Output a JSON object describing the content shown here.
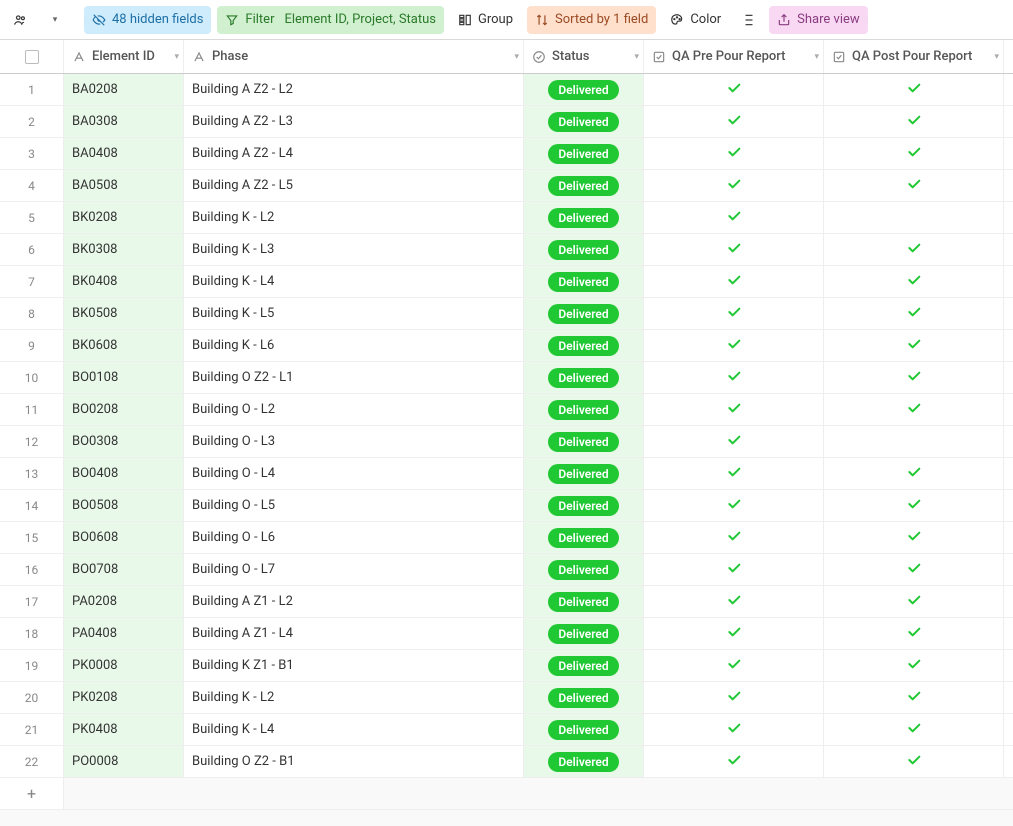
{
  "toolbar": {
    "hidden_fields": "48 hidden fields",
    "filter_label": "Filter",
    "filter_detail": "Element ID, Project, Status",
    "group": "Group",
    "sorted": "Sorted by 1 field",
    "color": "Color",
    "share": "Share view"
  },
  "columns": {
    "element_id": "Element ID",
    "phase": "Phase",
    "status": "Status",
    "qa_pre": "QA Pre Pour Report",
    "qa_post": "QA Post Pour Report"
  },
  "status_pill": "Delivered",
  "rows": [
    {
      "n": "1",
      "id": "BA0208",
      "phase": "Building A Z2 - L2",
      "status": "Delivered",
      "pre": true,
      "post": true
    },
    {
      "n": "2",
      "id": "BA0308",
      "phase": "Building A Z2 - L3",
      "status": "Delivered",
      "pre": true,
      "post": true
    },
    {
      "n": "3",
      "id": "BA0408",
      "phase": "Building A Z2 - L4",
      "status": "Delivered",
      "pre": true,
      "post": true
    },
    {
      "n": "4",
      "id": "BA0508",
      "phase": "Building A Z2 - L5",
      "status": "Delivered",
      "pre": true,
      "post": true
    },
    {
      "n": "5",
      "id": "BK0208",
      "phase": "Building K - L2",
      "status": "Delivered",
      "pre": true,
      "post": false
    },
    {
      "n": "6",
      "id": "BK0308",
      "phase": "Building K - L3",
      "status": "Delivered",
      "pre": true,
      "post": true
    },
    {
      "n": "7",
      "id": "BK0408",
      "phase": "Building K - L4",
      "status": "Delivered",
      "pre": true,
      "post": true
    },
    {
      "n": "8",
      "id": "BK0508",
      "phase": "Building K - L5",
      "status": "Delivered",
      "pre": true,
      "post": true
    },
    {
      "n": "9",
      "id": "BK0608",
      "phase": "Building K - L6",
      "status": "Delivered",
      "pre": true,
      "post": true
    },
    {
      "n": "10",
      "id": "BO0108",
      "phase": "Building O Z2 - L1",
      "status": "Delivered",
      "pre": true,
      "post": true
    },
    {
      "n": "11",
      "id": "BO0208",
      "phase": "Building O - L2",
      "status": "Delivered",
      "pre": true,
      "post": true
    },
    {
      "n": "12",
      "id": "BO0308",
      "phase": "Building O - L3",
      "status": "Delivered",
      "pre": true,
      "post": false
    },
    {
      "n": "13",
      "id": "BO0408",
      "phase": "Building O - L4",
      "status": "Delivered",
      "pre": true,
      "post": true
    },
    {
      "n": "14",
      "id": "BO0508",
      "phase": "Building O - L5",
      "status": "Delivered",
      "pre": true,
      "post": true
    },
    {
      "n": "15",
      "id": "BO0608",
      "phase": "Building O - L6",
      "status": "Delivered",
      "pre": true,
      "post": true
    },
    {
      "n": "16",
      "id": "BO0708",
      "phase": "Building O - L7",
      "status": "Delivered",
      "pre": true,
      "post": true
    },
    {
      "n": "17",
      "id": "PA0208",
      "phase": "Building A Z1 - L2",
      "status": "Delivered",
      "pre": true,
      "post": true
    },
    {
      "n": "18",
      "id": "PA0408",
      "phase": "Building A Z1 - L4",
      "status": "Delivered",
      "pre": true,
      "post": true
    },
    {
      "n": "19",
      "id": "PK0008",
      "phase": "Building K Z1 - B1",
      "status": "Delivered",
      "pre": true,
      "post": true
    },
    {
      "n": "20",
      "id": "PK0208",
      "phase": "Building K - L2",
      "status": "Delivered",
      "pre": true,
      "post": true
    },
    {
      "n": "21",
      "id": "PK0408",
      "phase": "Building K - L4",
      "status": "Delivered",
      "pre": true,
      "post": true
    },
    {
      "n": "22",
      "id": "PO0008",
      "phase": "Building O Z2 - B1",
      "status": "Delivered",
      "pre": true,
      "post": true
    }
  ],
  "add_row_label": "+"
}
